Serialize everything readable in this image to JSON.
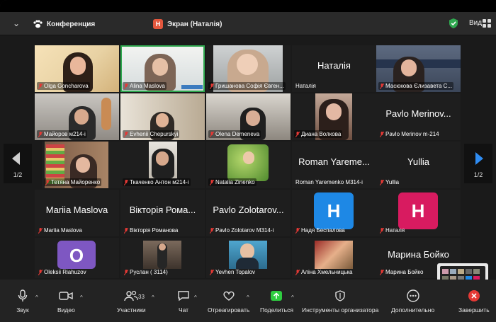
{
  "topbar": {
    "tab_meeting": "Конференция",
    "tab_screen": "Экран (Наталія)",
    "screen_icon_letter": "Н",
    "view_label": "Вид"
  },
  "pagination": {
    "left": "1/2",
    "right": "1/2"
  },
  "tiles": [
    {
      "id": "t1",
      "name": "Olga Goncharova",
      "big": ""
    },
    {
      "id": "t2",
      "name": "Alina Maslova",
      "big": ""
    },
    {
      "id": "t3",
      "name": "Гришанова Софія Євген...",
      "big": ""
    },
    {
      "id": "t4",
      "name": "Наталія",
      "big": "Наталія"
    },
    {
      "id": "t5",
      "name": "Масюкова Єлизавета С...",
      "big": ""
    },
    {
      "id": "t6",
      "name": "Майоров м214-і",
      "big": ""
    },
    {
      "id": "t7",
      "name": "Evhenii Chepurskyi",
      "big": ""
    },
    {
      "id": "t8",
      "name": "Olena Demeneva",
      "big": ""
    },
    {
      "id": "t9",
      "name": "Диана Волкова",
      "big": ""
    },
    {
      "id": "t10",
      "name": "Pavlo Merinov m-214",
      "big": "Pavlo Merinov..."
    },
    {
      "id": "t11",
      "name": "Тетяна Майоренко",
      "big": ""
    },
    {
      "id": "t12",
      "name": "Ткаченко Антон м214-і",
      "big": ""
    },
    {
      "id": "t13",
      "name": "Natalia Zinenko",
      "big": ""
    },
    {
      "id": "t14",
      "name": "Roman Yaremenko  М314-і",
      "big": "Roman Yareme..."
    },
    {
      "id": "t15",
      "name": "Yullia",
      "big": "Yullia"
    },
    {
      "id": "t16",
      "name": "Mariia Maslova",
      "big": "Mariia Maslova"
    },
    {
      "id": "t17",
      "name": "Вікторія Романова",
      "big": "Вікторія Рома..."
    },
    {
      "id": "t18",
      "name": "Pavlo Zolotarov М314-і",
      "big": "Pavlo Zolotarov..."
    },
    {
      "id": "t19",
      "name": "Надя Беспалова",
      "big": "",
      "avatar": "Н"
    },
    {
      "id": "t20",
      "name": "Наталя",
      "big": "",
      "avatar": "Н"
    },
    {
      "id": "t21",
      "name": "Oleksii Riahuzov",
      "big": "",
      "avatar": "O"
    },
    {
      "id": "t22",
      "name": "Руслан  ( 3114)",
      "big": ""
    },
    {
      "id": "t23",
      "name": "Yevhen Topalov",
      "big": ""
    },
    {
      "id": "t24",
      "name": "Аліна Хмельницька",
      "big": ""
    },
    {
      "id": "t25",
      "name": "Марина Бойко",
      "big": "Марина Бойко"
    }
  ],
  "toolbar": {
    "audio": "Звук",
    "video": "Видео",
    "participants": "Участники",
    "participants_count": "33",
    "chat": "Чат",
    "react": "Отреагировать",
    "share": "Поделиться",
    "host_tools": "Инструменты организатора",
    "more": "Дополнительно",
    "end": "Завершить"
  },
  "colors": {
    "active_border": "#2fa84f",
    "avatar_blue": "#1e88e5",
    "avatar_pink": "#d81b60",
    "avatar_purple": "#7e57c2",
    "share_green": "#2ecc40",
    "end_red": "#e53935"
  }
}
